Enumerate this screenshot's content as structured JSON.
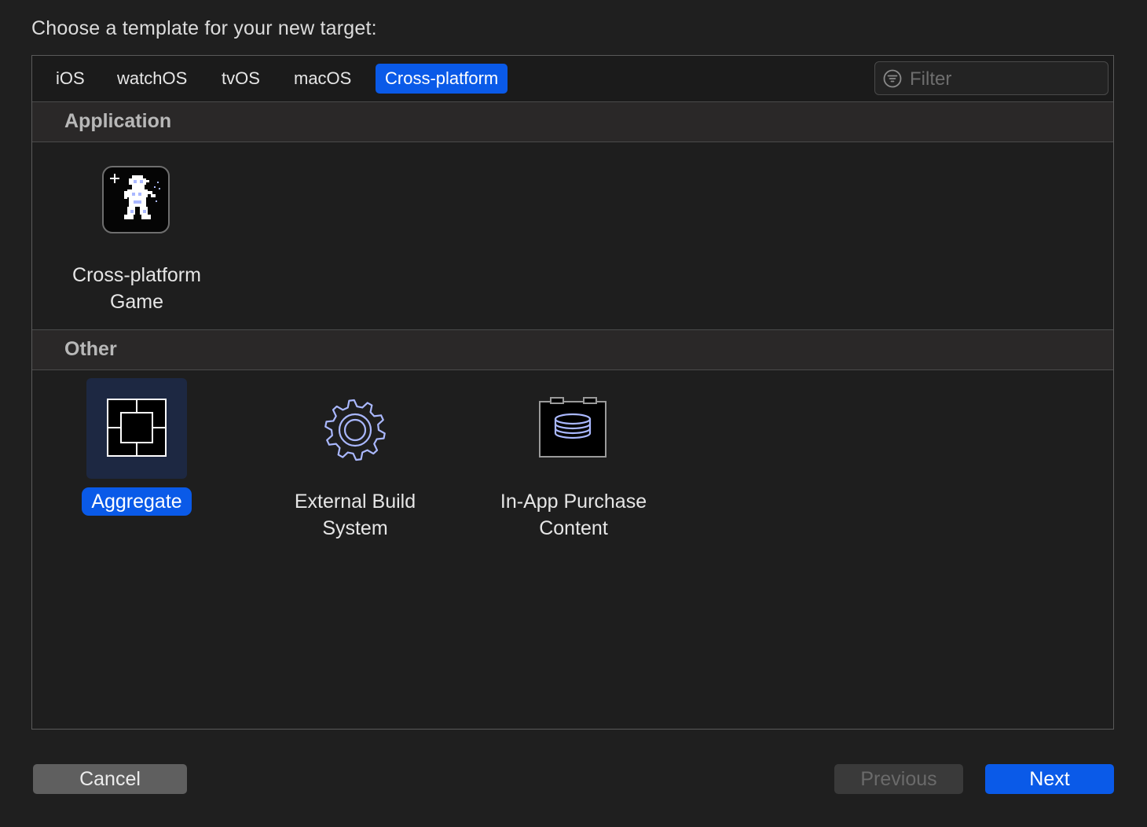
{
  "prompt": "Choose a template for your new target:",
  "tabs": [
    {
      "label": "iOS"
    },
    {
      "label": "watchOS"
    },
    {
      "label": "tvOS"
    },
    {
      "label": "macOS"
    },
    {
      "label": "Cross-platform",
      "active": true
    }
  ],
  "filter": {
    "placeholder": "Filter",
    "value": "",
    "icon": "filter-icon"
  },
  "sections": [
    {
      "title": "Application",
      "items": [
        {
          "line1": "Cross-platform",
          "line2": "Game",
          "icon": "game-sprite-icon"
        }
      ]
    },
    {
      "title": "Other",
      "items": [
        {
          "line1": "Aggregate",
          "line2": "",
          "icon": "aggregate-icon",
          "selected": true
        },
        {
          "line1": "External Build",
          "line2": "System",
          "icon": "gear-icon"
        },
        {
          "line1": "In-App Purchase",
          "line2": "Content",
          "icon": "coins-box-icon"
        }
      ]
    }
  ],
  "buttons": {
    "cancel": "Cancel",
    "previous": "Previous",
    "next": "Next"
  },
  "colors": {
    "accent": "#0a5ae8",
    "background": "#1f1f1f",
    "section_header": "#2a2828",
    "icon_stroke": "#aab8ff"
  }
}
